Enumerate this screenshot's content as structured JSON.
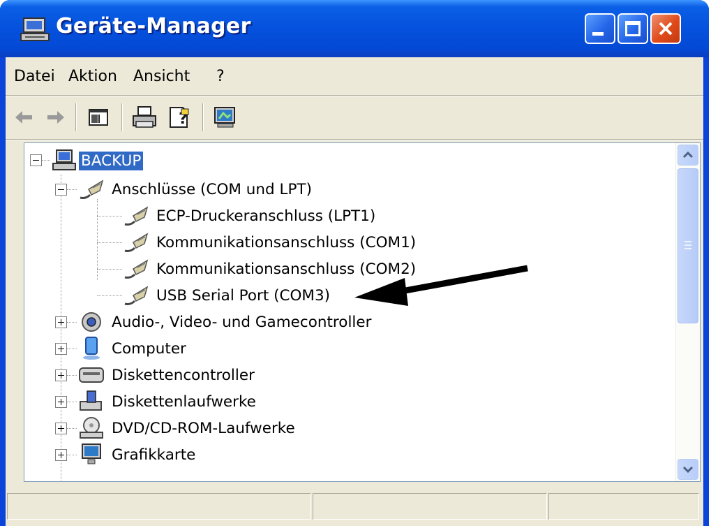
{
  "window": {
    "title": "Geräte-Manager"
  },
  "menu": [
    {
      "label": "Datei"
    },
    {
      "label": "Aktion"
    },
    {
      "label": "Ansicht"
    },
    {
      "label": "?"
    }
  ],
  "toolbar": {
    "icons": [
      "back-arrow-icon",
      "forward-arrow-icon",
      "show-hide-console-tree-icon",
      "print-icon",
      "help-icon",
      "scan-hardware-icon"
    ]
  },
  "tree": {
    "root": {
      "label": "BACKUP",
      "selected": true
    },
    "ports_category": {
      "label": "Anschlüsse (COM und LPT)",
      "expanded": true
    },
    "ports": [
      {
        "label": "ECP-Druckeranschluss (LPT1)"
      },
      {
        "label": "Kommunikationsanschluss (COM1)"
      },
      {
        "label": "Kommunikationsanschluss (COM2)"
      },
      {
        "label": "USB Serial Port (COM3)"
      }
    ],
    "categories": [
      {
        "label": "Audio-, Video- und Gamecontroller",
        "icon": "speaker-icon"
      },
      {
        "label": "Computer",
        "icon": "computer-icon"
      },
      {
        "label": "Diskettencontroller",
        "icon": "floppy-controller-icon"
      },
      {
        "label": "Diskettenlaufwerke",
        "icon": "floppy-drive-icon"
      },
      {
        "label": "DVD/CD-ROM-Laufwerke",
        "icon": "cd-drive-icon"
      },
      {
        "label": "Grafikkarte",
        "icon": "monitor-icon"
      }
    ]
  },
  "colors": {
    "titlebar": "#0551dc",
    "selection": "#316ac5",
    "annotation_arrow": "#000000"
  }
}
